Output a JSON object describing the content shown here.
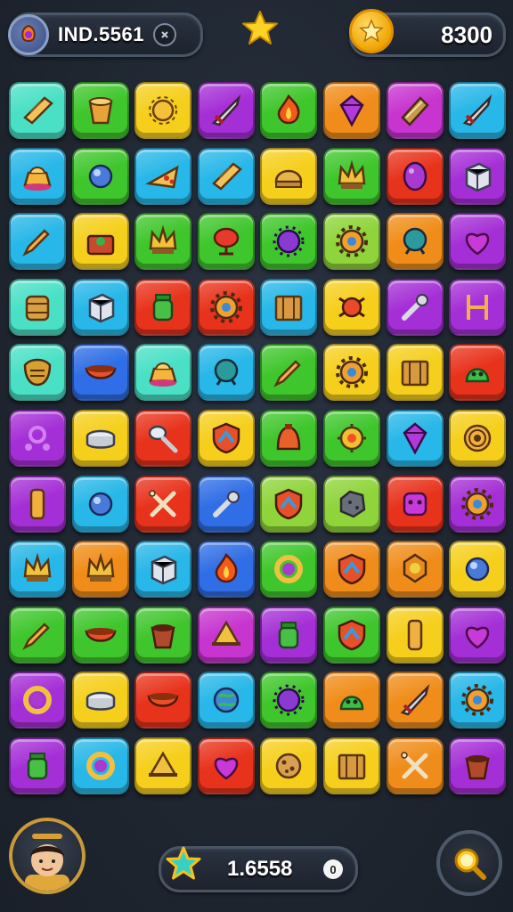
{
  "header": {
    "player_id": "IND.5561",
    "coins": "8300",
    "id_badge_text": "",
    "top_star_icon": "star-icon"
  },
  "footer": {
    "score": "1.6558",
    "score_badge_text": "0",
    "avatar_icon": "player-avatar",
    "search_icon": "magnifier-icon"
  },
  "colors": {
    "teal": "#49e0c6",
    "green": "#3fc62c",
    "yellow": "#f6cf1c",
    "purple": "#a52fd6",
    "orange": "#f08d1a",
    "cyan": "#27b7e8",
    "red": "#e8331c",
    "blue": "#2f6ee6",
    "lime": "#8fd43a",
    "magenta": "#c734cf"
  },
  "board": {
    "rows": [
      [
        {
          "c": "teal",
          "i": "scroll"
        },
        {
          "c": "green",
          "i": "bucket"
        },
        {
          "c": "yellow",
          "i": "sun"
        },
        {
          "c": "purple",
          "i": "sword"
        },
        {
          "c": "green",
          "i": "flame"
        },
        {
          "c": "orange",
          "i": "gem"
        },
        {
          "c": "magenta",
          "i": "book"
        },
        {
          "c": "cyan",
          "i": "sword"
        }
      ],
      [
        {
          "c": "cyan",
          "i": "cake"
        },
        {
          "c": "green",
          "i": "orb"
        },
        {
          "c": "cyan",
          "i": "pizza"
        },
        {
          "c": "cyan",
          "i": "scroll"
        },
        {
          "c": "yellow",
          "i": "helmet"
        },
        {
          "c": "green",
          "i": "crown"
        },
        {
          "c": "red",
          "i": "egg"
        },
        {
          "c": "purple",
          "i": "box"
        }
      ],
      [
        {
          "c": "cyan",
          "i": "pencil"
        },
        {
          "c": "yellow",
          "i": "chest"
        },
        {
          "c": "green",
          "i": "crown"
        },
        {
          "c": "green",
          "i": "lamp"
        },
        {
          "c": "green",
          "i": "urchin"
        },
        {
          "c": "lime",
          "i": "gear"
        },
        {
          "c": "orange",
          "i": "portal"
        },
        {
          "c": "purple",
          "i": "heart"
        }
      ],
      [
        {
          "c": "teal",
          "i": "barrel"
        },
        {
          "c": "cyan",
          "i": "box"
        },
        {
          "c": "red",
          "i": "jar"
        },
        {
          "c": "red",
          "i": "gear"
        },
        {
          "c": "cyan",
          "i": "crate"
        },
        {
          "c": "yellow",
          "i": "bug"
        },
        {
          "c": "purple",
          "i": "wrench"
        },
        {
          "c": "purple",
          "i": "chair"
        }
      ],
      [
        {
          "c": "teal",
          "i": "mask"
        },
        {
          "c": "blue",
          "i": "bowl"
        },
        {
          "c": "teal",
          "i": "cake"
        },
        {
          "c": "cyan",
          "i": "portal"
        },
        {
          "c": "green",
          "i": "pencil"
        },
        {
          "c": "yellow",
          "i": "gear"
        },
        {
          "c": "yellow",
          "i": "crate"
        },
        {
          "c": "red",
          "i": "slime"
        }
      ],
      [
        {
          "c": "purple",
          "i": "swirl"
        },
        {
          "c": "yellow",
          "i": "pot"
        },
        {
          "c": "red",
          "i": "spoon"
        },
        {
          "c": "yellow",
          "i": "shield"
        },
        {
          "c": "green",
          "i": "bell"
        },
        {
          "c": "green",
          "i": "robot"
        },
        {
          "c": "cyan",
          "i": "gem"
        },
        {
          "c": "yellow",
          "i": "shell"
        }
      ],
      [
        {
          "c": "purple",
          "i": "tube"
        },
        {
          "c": "cyan",
          "i": "orb"
        },
        {
          "c": "red",
          "i": "bones"
        },
        {
          "c": "blue",
          "i": "wrench"
        },
        {
          "c": "lime",
          "i": "shield"
        },
        {
          "c": "lime",
          "i": "rock"
        },
        {
          "c": "red",
          "i": "face"
        },
        {
          "c": "purple",
          "i": "gear"
        }
      ],
      [
        {
          "c": "cyan",
          "i": "crown"
        },
        {
          "c": "orange",
          "i": "crown"
        },
        {
          "c": "cyan",
          "i": "box"
        },
        {
          "c": "blue",
          "i": "flame"
        },
        {
          "c": "green",
          "i": "ring"
        },
        {
          "c": "orange",
          "i": "shield"
        },
        {
          "c": "orange",
          "i": "badge"
        },
        {
          "c": "yellow",
          "i": "orb"
        }
      ],
      [
        {
          "c": "green",
          "i": "pencil"
        },
        {
          "c": "green",
          "i": "bowl"
        },
        {
          "c": "green",
          "i": "cup"
        },
        {
          "c": "magenta",
          "i": "hat"
        },
        {
          "c": "purple",
          "i": "jar"
        },
        {
          "c": "green",
          "i": "shield"
        },
        {
          "c": "yellow",
          "i": "tube"
        },
        {
          "c": "purple",
          "i": "heart"
        }
      ],
      [
        {
          "c": "purple",
          "i": "ring"
        },
        {
          "c": "yellow",
          "i": "pot"
        },
        {
          "c": "red",
          "i": "bowl"
        },
        {
          "c": "cyan",
          "i": "globe"
        },
        {
          "c": "green",
          "i": "urchin"
        },
        {
          "c": "orange",
          "i": "slime"
        },
        {
          "c": "orange",
          "i": "sword"
        },
        {
          "c": "cyan",
          "i": "gear"
        }
      ],
      [
        {
          "c": "purple",
          "i": "jar"
        },
        {
          "c": "cyan",
          "i": "ring"
        },
        {
          "c": "yellow",
          "i": "hat"
        },
        {
          "c": "red",
          "i": "heart"
        },
        {
          "c": "yellow",
          "i": "cookie"
        },
        {
          "c": "yellow",
          "i": "crate"
        },
        {
          "c": "orange",
          "i": "bones"
        },
        {
          "c": "purple",
          "i": "cup"
        }
      ]
    ]
  }
}
